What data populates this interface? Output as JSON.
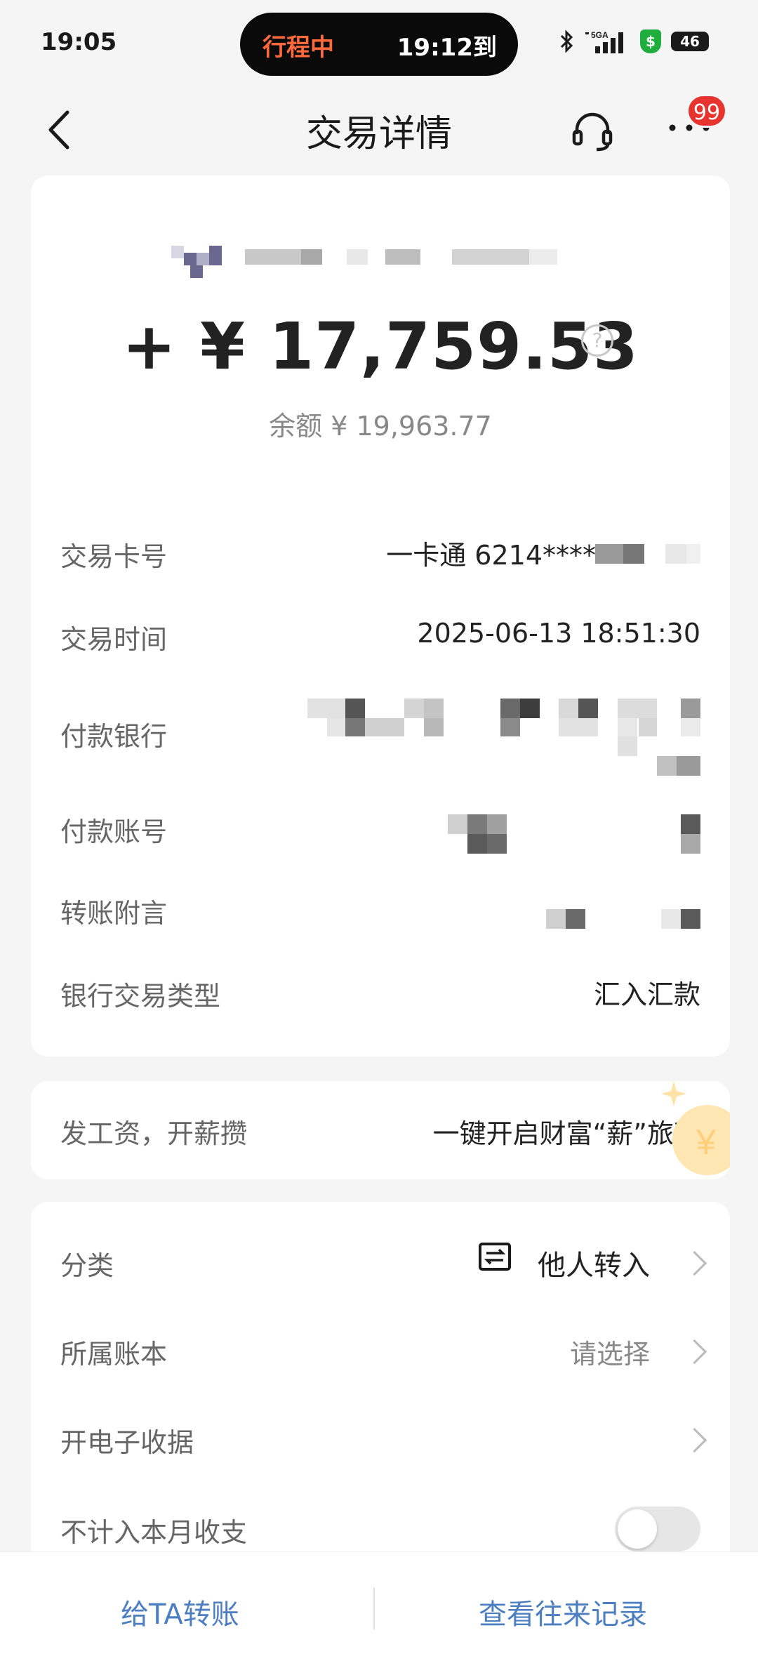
{
  "status_bar": {
    "time": "19:05",
    "trip_label": "行程中",
    "trip_eta": "19:12到",
    "battery": "46",
    "icons": [
      "bluetooth-icon",
      "signal-5g-icon",
      "shield-icon",
      "battery-icon"
    ]
  },
  "nav": {
    "title": "交易详情",
    "back_icon": "chevron-left-icon",
    "service_icon": "headset-icon",
    "more_icon": "more-dots-icon",
    "more_badge": "99"
  },
  "summary": {
    "amount": "+ ¥ 17,759.53",
    "balance": "余额 ¥ 19,963.77"
  },
  "details": [
    {
      "label": "交易卡号",
      "value": "一卡通 6214*****"
    },
    {
      "label": "交易时间",
      "value": "2025-06-13 18:51:30"
    },
    {
      "label": "付款银行",
      "value": ""
    },
    {
      "label": "付款账号",
      "value": ""
    },
    {
      "label": "转账附言",
      "value": ""
    },
    {
      "label": "银行交易类型",
      "value": "汇入汇款"
    }
  ],
  "promo": {
    "left": "发工资，开薪攒",
    "right": "一键开启财富“薪”旅程"
  },
  "category": {
    "rows": [
      {
        "label": "分类",
        "value": "他人转入",
        "icon": "transfer-icon"
      },
      {
        "label": "所属账本",
        "value": "请选择"
      },
      {
        "label": "开电子收据",
        "value": ""
      },
      {
        "label": "不计入本月收支",
        "toggle": false
      }
    ]
  },
  "bottom": {
    "transfer": "给TA转账",
    "history": "查看往来记录"
  },
  "colors": {
    "accent": "#4c7ec0",
    "trip_orange": "#ff6a3c",
    "badge_red": "#e8342e",
    "background": "#f5f5f5"
  }
}
